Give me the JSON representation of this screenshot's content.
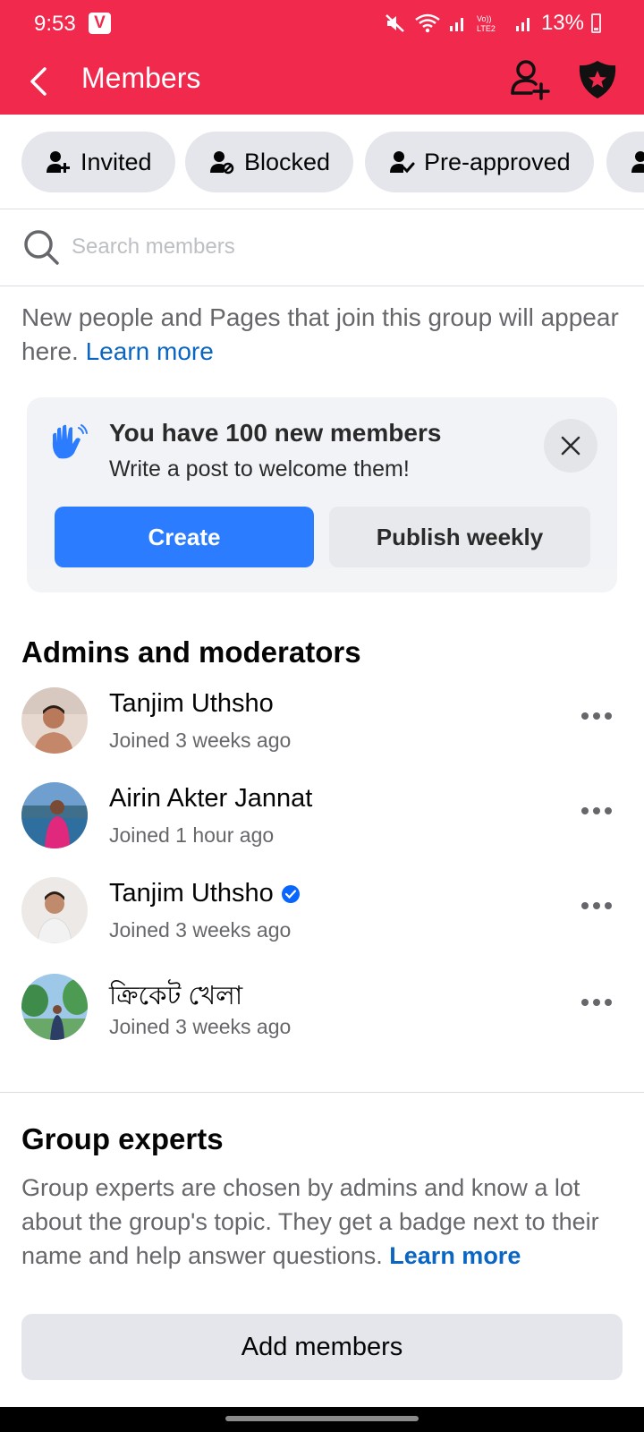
{
  "status_bar": {
    "time": "9:53",
    "carrier_badge": "V",
    "battery_percent": "13%"
  },
  "header": {
    "title": "Members",
    "back_icon": "back-arrow-icon",
    "add_person_icon": "add-person-icon",
    "admin_shield_icon": "admin-shield-icon",
    "brand_color": "#f0294d"
  },
  "filter_chips": [
    {
      "label": "Invited",
      "icon": "person-plus-icon"
    },
    {
      "label": "Blocked",
      "icon": "person-blocked-icon"
    },
    {
      "label": "Pre-approved",
      "icon": "person-check-icon"
    }
  ],
  "search": {
    "placeholder": "Search members",
    "value": ""
  },
  "info": {
    "text": "New people and Pages that join this group will appear here.",
    "link": "Learn more"
  },
  "welcome_card": {
    "title": "You have 100 new members",
    "subtitle": "Write a post to welcome them!",
    "create_label": "Create",
    "publish_label": "Publish weekly",
    "primary_color": "#0866ff"
  },
  "admins_section": {
    "title": "Admins and moderators",
    "members": [
      {
        "name": "Tanjim Uthsho",
        "joined": "Joined 3 weeks ago",
        "verified": false
      },
      {
        "name": "Airin Akter Jannat",
        "joined": "Joined 1 hour ago",
        "verified": false
      },
      {
        "name": "Tanjim Uthsho",
        "joined": "Joined 3 weeks ago",
        "verified": true
      },
      {
        "name": "ক্রিকেট খেলা",
        "joined": "Joined 3 weeks ago",
        "verified": false
      }
    ]
  },
  "experts_section": {
    "title": "Group experts",
    "description": "Group experts are chosen by admins and know a lot about the group's topic. They get a badge next to their name and help answer questions.",
    "link": "Learn more"
  },
  "add_members_label": "Add members"
}
